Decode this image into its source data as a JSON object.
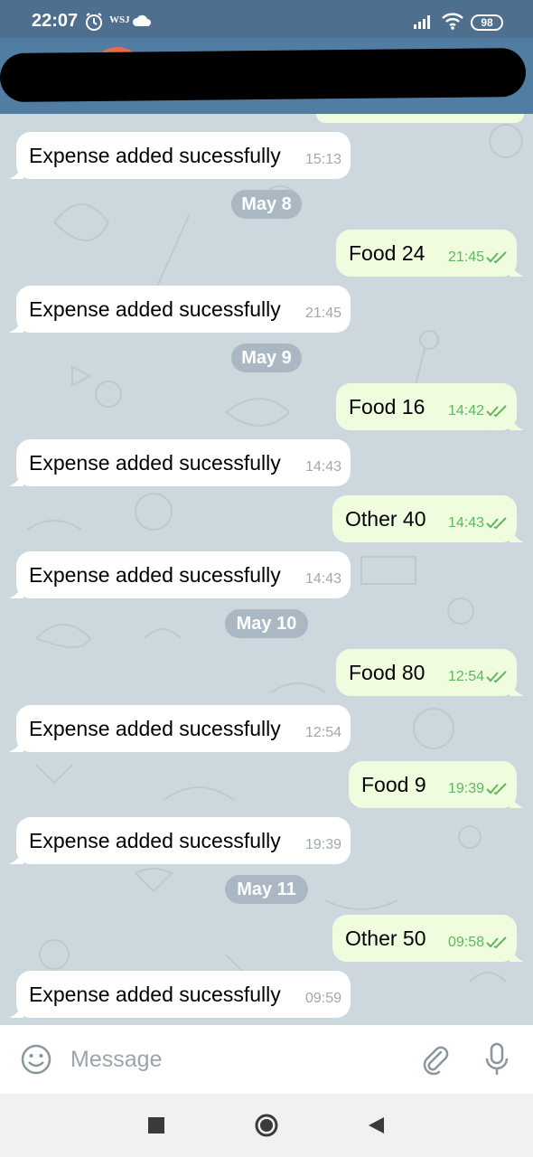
{
  "status_bar": {
    "time": "22:07",
    "carrier_badge": "WSJ",
    "battery": "98"
  },
  "header": {
    "redacted": true
  },
  "chat": {
    "messages": [
      {
        "direction": "in",
        "text": "Expense added sucessfully",
        "time": "15:13"
      },
      {
        "type": "date",
        "text": "May 8"
      },
      {
        "direction": "out",
        "text": "Food 24",
        "time": "21:45"
      },
      {
        "direction": "in",
        "text": "Expense added sucessfully",
        "time": "21:45"
      },
      {
        "type": "date",
        "text": "May 9"
      },
      {
        "direction": "out",
        "text": "Food 16",
        "time": "14:42"
      },
      {
        "direction": "in",
        "text": "Expense added sucessfully",
        "time": "14:43"
      },
      {
        "direction": "out",
        "text": "Other 40",
        "time": "14:43"
      },
      {
        "direction": "in",
        "text": "Expense added sucessfully",
        "time": "14:43"
      },
      {
        "type": "date",
        "text": "May 10"
      },
      {
        "direction": "out",
        "text": "Food 80",
        "time": "12:54"
      },
      {
        "direction": "in",
        "text": "Expense added sucessfully",
        "time": "12:54"
      },
      {
        "direction": "out",
        "text": "Food 9",
        "time": "19:39"
      },
      {
        "direction": "in",
        "text": "Expense added sucessfully",
        "time": "19:39"
      },
      {
        "type": "date",
        "text": "May 11"
      },
      {
        "direction": "out",
        "text": "Other 50",
        "time": "09:58"
      },
      {
        "direction": "in",
        "text": "Expense added sucessfully",
        "time": "09:59"
      }
    ]
  },
  "input": {
    "placeholder": "Message",
    "icons": [
      "emoji-icon",
      "paperclip-icon",
      "microphone-icon"
    ]
  },
  "nav": {
    "icons": [
      "recents-square-icon",
      "home-circle-icon",
      "back-triangle-icon"
    ]
  },
  "colors": {
    "header": "#527da3",
    "status_bar": "#4f6f8f",
    "chat_background": "#cdd8de",
    "incoming_bubble": "#ffffff",
    "outgoing_bubble": "#effdde",
    "outgoing_time": "#5db85f",
    "date_pill": "#a9b8c2"
  }
}
